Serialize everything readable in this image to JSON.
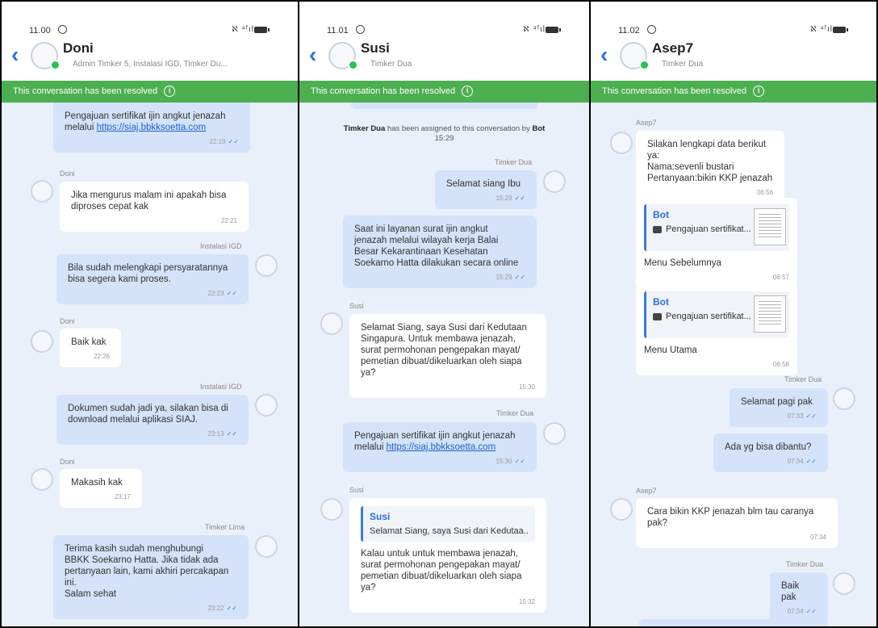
{
  "panels": [
    {
      "status_time": "11.00",
      "status_signal": "ℵ ⁴ᶠıl",
      "contact_name": "Doni",
      "contact_subtitle": "Admin Timker 5, Instalasi IGD, Timker Du...",
      "resolved_banner": "This conversation has been resolved",
      "info_glyph": "i",
      "back_glyph": "‹",
      "messages": [
        {
          "text_pre": "Pengajuan sertifikat ijin angkut jenazah\nmelalui ",
          "link": "https://siaj.bbkksoetta.com",
          "time": "22:19",
          "tick": "✓✓"
        },
        {
          "sender": "Doni",
          "text": "Jika mengurus malam ini apakah bisa\ndiproses cepat kak",
          "time": "22:21"
        },
        {
          "sender": "Instalasi IGD",
          "text": "Bila sudah melengkapi persyaratannya\nbisa segera kami proses.",
          "time": "22:23",
          "tick": "✓✓"
        },
        {
          "sender": "Doni",
          "text": "Baik kak",
          "time": "22:26"
        },
        {
          "sender": "Instalasi IGD",
          "text": "Dokumen sudah jadi ya, silakan bisa di\ndownload melalui aplikasi SIAJ.",
          "time": "23:13",
          "tick": "✓✓"
        },
        {
          "sender": "Doni",
          "text": "Makasih kak",
          "time": "23:17"
        },
        {
          "sender": "Timker Lima",
          "text": "Terima kasih sudah menghubungi\nBBKK Soekarno Hatta. Jika tidak ada\npertanyaan lain, kami akhiri percakapan\nini.\nSalam sehat",
          "time": "23:22",
          "tick": "✓✓"
        }
      ]
    },
    {
      "status_time": "11.01",
      "status_signal": "ℵ ⁴ᶠıl",
      "contact_name": "Susi",
      "contact_subtitle": "Timker Dua",
      "resolved_banner": "This conversation has been resolved",
      "info_glyph": "i",
      "back_glyph": "‹",
      "system": {
        "who": "Timker Dua",
        "text": " has been assigned to this conversation by ",
        "by": "Bot",
        "time": "15:29"
      },
      "messages": [
        {
          "sender": "Timker Dua",
          "text": "Selamat siang Ibu",
          "time": "15:29",
          "tick": "✓✓"
        },
        {
          "text": "Saat ini layanan surat ijin angkut\njenazah melalui wilayah kerja Balai\nBesar Kekarantinaan Kesehatan\nSoekarno Hatta dilakukan secara online",
          "time": "15:29",
          "tick": "✓✓"
        },
        {
          "sender": "Susi",
          "text": "Selamat Siang, saya Susi dari Kedutaan\nSingapura. Untuk membawa jenazah,\nsurat permohonan pengepakan mayat/\npemetian dibuat/dikeluarkan oleh siapa\nya?",
          "time": "15:30"
        },
        {
          "sender": "Timker Dua",
          "text_pre": "Pengajuan sertifikat ijin angkut jenazah\nmelalui ",
          "link": "https://siaj.bbkksoetta.com",
          "time": "15:30",
          "tick": "✓✓"
        },
        {
          "sender": "Susi",
          "reply_name": "Susi",
          "reply_text": "Selamat Siang, saya Susi dari Kedutaa...",
          "text": "Kalau untuk untuk membawa jenazah,\nsurat permohonan pengepakan mayat/\npemetian dibuat/dikeluarkan oleh siapa\nya?",
          "time": "15:32"
        }
      ]
    },
    {
      "status_time": "11.02",
      "status_signal": "ℵ ⁴ᶠıl",
      "contact_name": "Asep7",
      "contact_subtitle": "Timker Dua",
      "resolved_banner": "This conversation has been resolved",
      "info_glyph": "i",
      "back_glyph": "‹",
      "messages": [
        {
          "sender": "Asep7",
          "text": "Silakan lengkapi data berikut ya:\nNama:sevenli bustari\nPertanyaan:bikin KKP jenazah",
          "time": "06:56"
        },
        {
          "reply_name": "Bot",
          "reply_text": "Pengajuan sertifikat...",
          "text": "Menu Sebelumnya",
          "time": "06:57"
        },
        {
          "reply_name": "Bot",
          "reply_text": "Pengajuan sertifikat...",
          "text": "Menu Utama",
          "time": "06:58"
        },
        {
          "sender": "Timker Dua",
          "text": "Selamat pagi pak",
          "time": "07:33",
          "tick": "✓✓"
        },
        {
          "text": "Ada yg bisa dibantu?",
          "time": "07:34",
          "tick": "✓✓"
        },
        {
          "sender": "Asep7",
          "text": "Cara bikin KKP jenazah blm tau caranya\npak?",
          "time": "07:34"
        },
        {
          "sender": "Timker Dua",
          "text": "Baik pak",
          "time": "07:34",
          "tick": "✓✓"
        }
      ]
    }
  ]
}
